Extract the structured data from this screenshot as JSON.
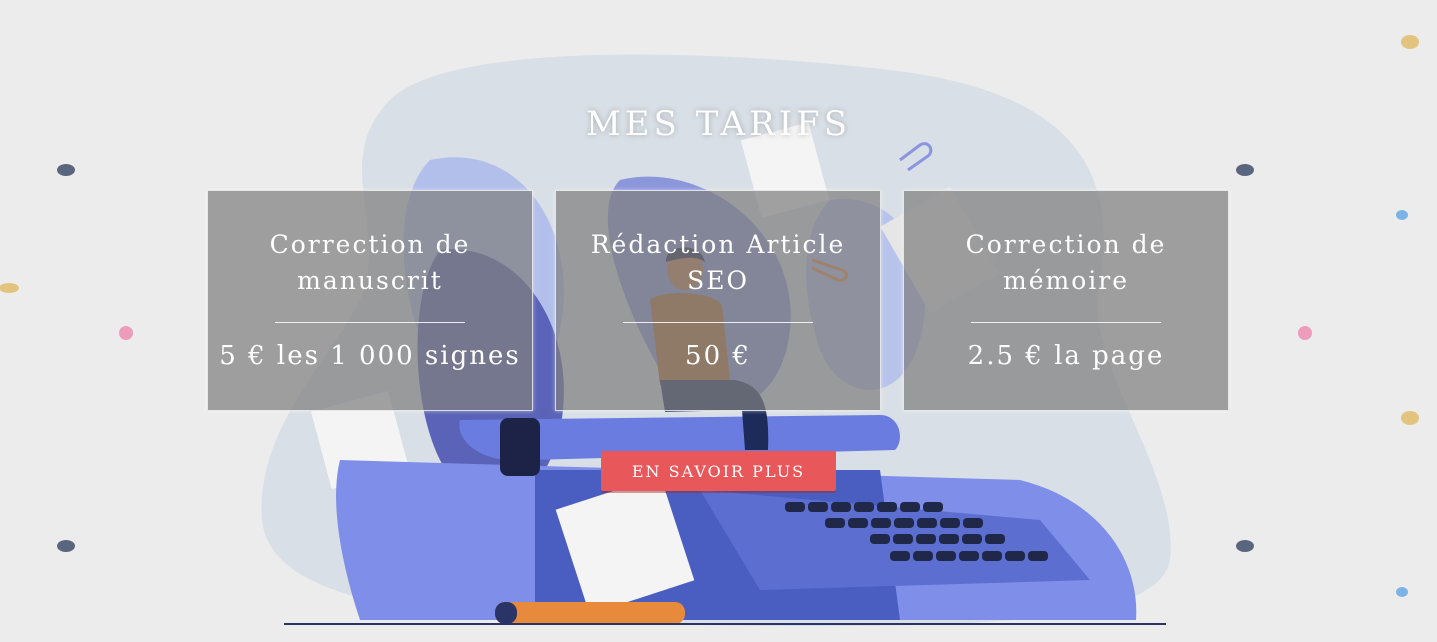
{
  "section": {
    "title": "MES TARIFS"
  },
  "pricing": [
    {
      "name": "Correction de manuscrit",
      "price": "5 € les 1 000 signes"
    },
    {
      "name": "Rédaction Article SEO",
      "price": "50 €"
    },
    {
      "name": "Correction de mémoire",
      "price": "2.5 € la page"
    }
  ],
  "cta": {
    "label": "EN SAVOIR PLUS"
  },
  "colors": {
    "background": "#ececec",
    "button": "#e8585a",
    "card": "#808080",
    "illustration_blue": "#5b6ee0",
    "illustration_orange": "#b8692a"
  },
  "illustration": {
    "icon": "writer-on-typewriter-illustration"
  }
}
